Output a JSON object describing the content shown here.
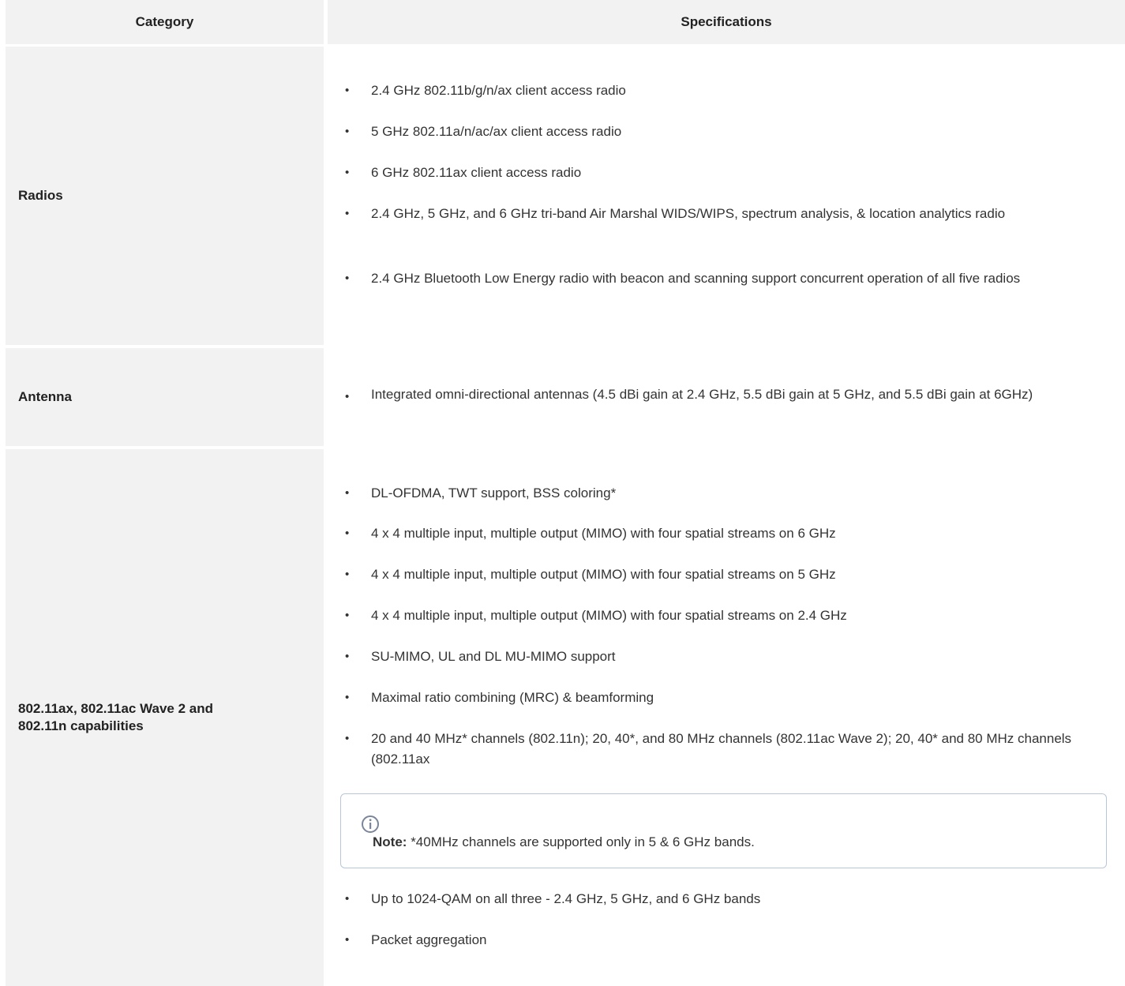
{
  "table": {
    "headers": {
      "category": "Category",
      "specifications": "Specifications"
    },
    "rows": [
      {
        "category": "Radios",
        "items": [
          "2.4 GHz 802.11b/g/n/ax client access radio",
          "5 GHz 802.11a/n/ac/ax client access radio",
          "6 GHz 802.11ax client access radio",
          "2.4 GHz, 5 GHz, and 6 GHz tri-band Air Marshal WIDS/WIPS, spectrum analysis, & location analytics radio",
          "2.4 GHz Bluetooth Low Energy radio with beacon and scanning support concurrent operation of all five radios"
        ]
      },
      {
        "category": "Antenna",
        "items": [
          "Integrated omni-directional antennas (4.5 dBi gain at 2.4 GHz, 5.5 dBi gain at 5 GHz, and 5.5 dBi gain at 6GHz)"
        ]
      },
      {
        "category": "802.11ax, 802.11ac Wave 2 and 802.11n capabilities",
        "items": [
          "DL-OFDMA, TWT support, BSS coloring*",
          "4 x 4 multiple input, multiple output (MIMO) with four spatial streams on 6 GHz",
          "4 x 4 multiple input, multiple output (MIMO) with four spatial streams on 5 GHz",
          "4 x 4 multiple input, multiple output (MIMO) with four spatial streams on 2.4 GHz",
          "SU-MIMO, UL and DL MU-MIMO support",
          "Maximal ratio combining (MRC) & beamforming",
          "20 and 40 MHz* channels (802.11n); 20, 40*, and 80 MHz channels (802.11ac Wave 2); 20, 40* and 80 MHz channels (802.11ax",
          "Up to 1024-QAM on all three - 2.4 GHz, 5 GHz, and 6 GHz bands",
          "Packet aggregation"
        ],
        "note": {
          "icon": "info-icon",
          "label": "Note:",
          "text": "*40MHz channels are supported only in 5 & 6 GHz bands."
        }
      }
    ],
    "bullet_glyph": "•"
  }
}
